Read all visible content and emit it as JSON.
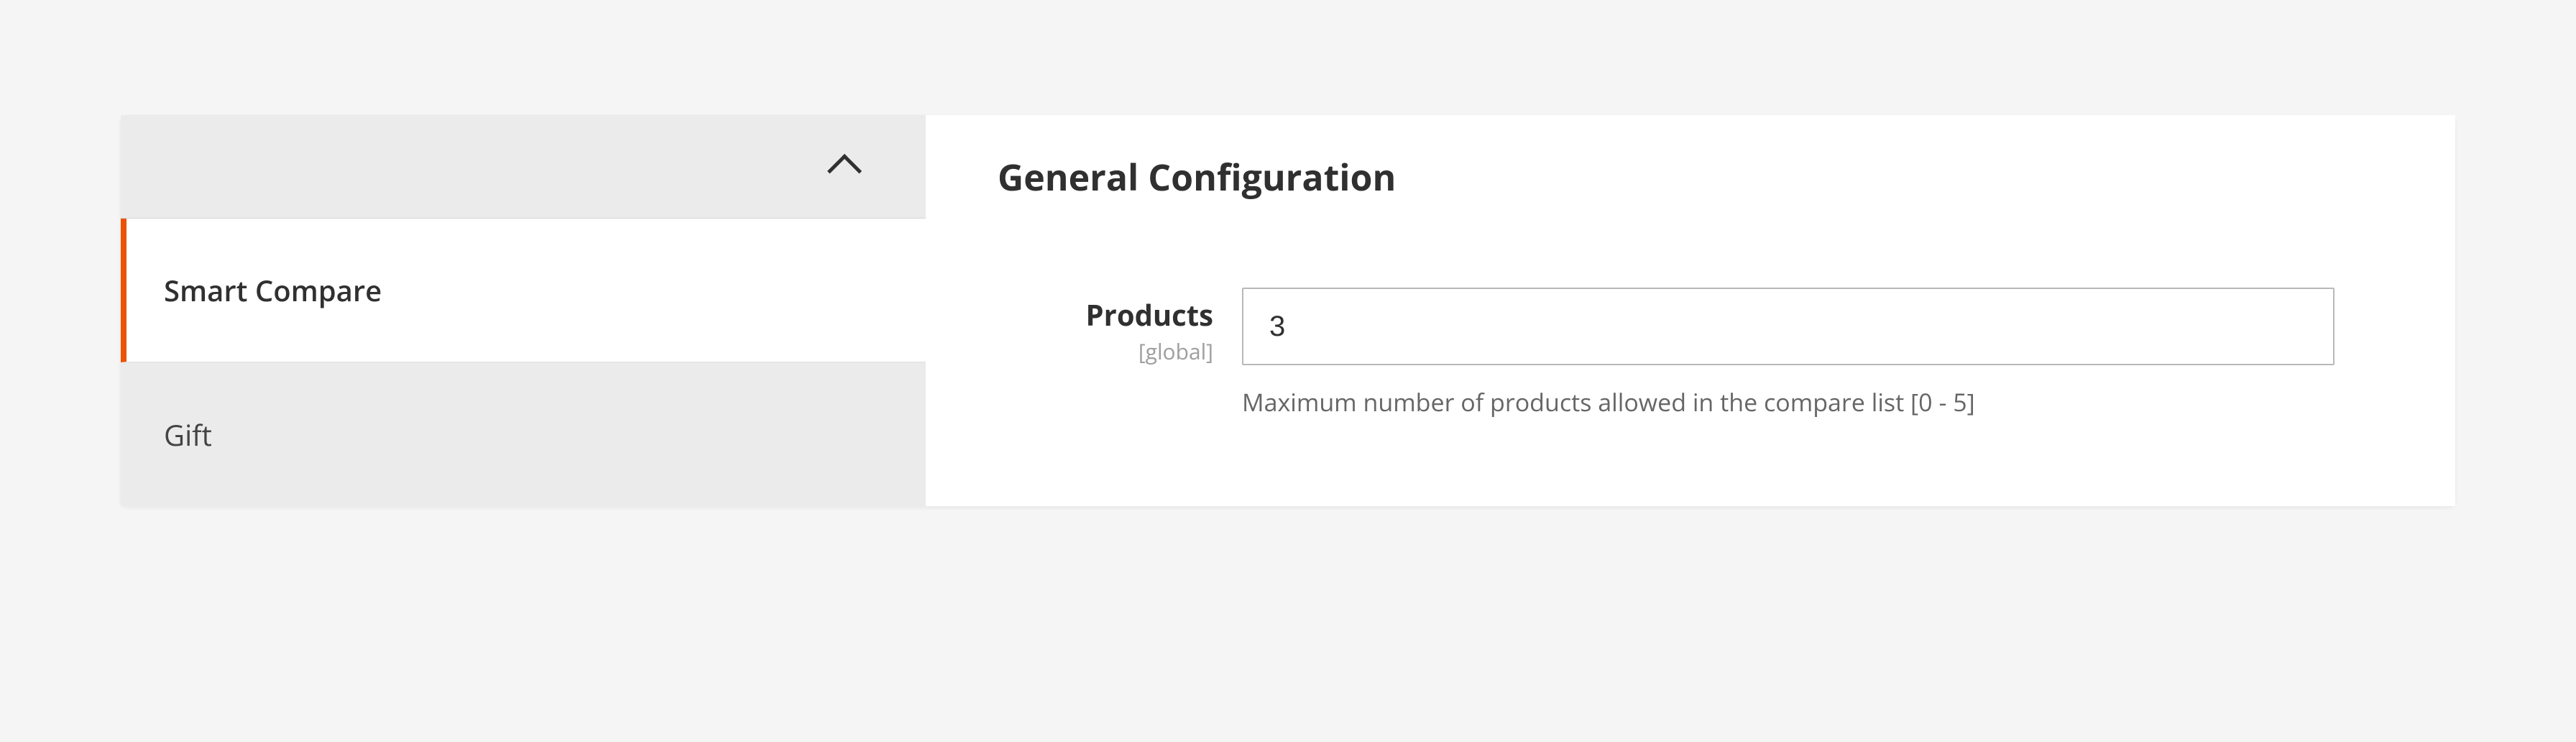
{
  "sidebar": {
    "items": [
      {
        "label": "Smart Compare"
      },
      {
        "label": "Gift"
      }
    ]
  },
  "section": {
    "title": "General Configuration"
  },
  "fields": {
    "products": {
      "label": "Products",
      "scope": "[global]",
      "value": "3",
      "hint": "Maximum number of products allowed in the compare list [0 - 5]"
    }
  }
}
